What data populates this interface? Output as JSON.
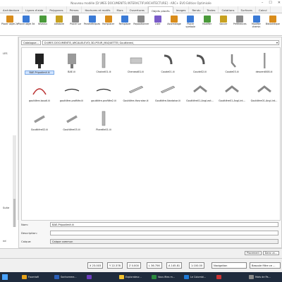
{
  "window": {
    "title": "Nouveau modèle [D:\\MES DOCUMENTS\\ INTERACTIF\\ARCHITECTURE] - ARC+ EVO Edition Optimisée"
  },
  "tabs": [
    "Architecture",
    "Lignes d'aide",
    "Polygones",
    "Primes",
    "Hachures et motifs",
    "Murs",
    "Ouvertures",
    "Objets placés",
    "Images",
    "Rendu",
    "Textes",
    "Cotations",
    "Surfaces",
    "Calcul"
  ],
  "active_tab": "Objets placés",
  "ribbon": {
    "buttons": [
      "Placer objet 2d",
      "Placer objet 3d",
      "Niveaux",
      "Aléatoire",
      "Placer sur",
      "Paramétriques",
      "Remplacer",
      "Remplacer",
      "Repositionner",
      "Liste",
      "Assemblage",
      "Placer symbole",
      "Modifier",
      "Sauver",
      "Préférences",
      "Modifier chemin",
      "Bibliothèque"
    ]
  },
  "left_panel": {
    "items": [
      "LES",
      "Suite",
      "nd"
    ]
  },
  "dialog": {
    "catalogue_label": "Catalogue...",
    "path": "D:\\MES DOCUMENTS\\ ARCALIB-EVO\\ 3D-POUR_MAQUETTE\\ Gouttieres\\",
    "items": [
      {
        "label": "BAE-Pripodimé.iii",
        "thumb": "box-black",
        "selected": true
      },
      {
        "label": "BAE.iii",
        "thumb": "box-gray"
      },
      {
        "label": "Chainel01.iii",
        "thumb": "pipe"
      },
      {
        "label": "Chenead01.iii",
        "thumb": "gutter"
      },
      {
        "label": "Coude01.iii",
        "thumb": "elbow"
      },
      {
        "label": "Coude02.iii",
        "thumb": "elbow"
      },
      {
        "label": "Coude03.iii",
        "thumb": "pipe-bend"
      },
      {
        "label": "descent008.iii",
        "thumb": "pipe-long"
      },
      {
        "label": "gouttière-boudl.iii",
        "thumb": "arc-red"
      },
      {
        "label": "gouttière-profilée.iii",
        "thumb": "gutter-thin"
      },
      {
        "label": "gouttière-profilée2.iii",
        "thumb": "gutter-thin"
      },
      {
        "label": "Gouttière-Havraise.iii",
        "thumb": "gutter-long"
      },
      {
        "label": "Gouttière-Nantaise.iii",
        "thumb": "gutter-long"
      },
      {
        "label": "Gouttière01-Angl-ext...",
        "thumb": "angle"
      },
      {
        "label": "Gouttière01-Angl-int...",
        "thumb": "angle"
      },
      {
        "label": "Gouttière01-Angl-int...",
        "thumb": "angle"
      },
      {
        "label": "Gouttière02.iii",
        "thumb": "gutter-short"
      },
      {
        "label": "Gouttière03.iii",
        "thumb": "gutter-short"
      },
      {
        "label": "Pizzette01.iii",
        "thumb": "pipe"
      }
    ],
    "fields": {
      "name_label": "Nom:",
      "name_value": "BAE-Pripodimé.iii",
      "desc_label": "Description:",
      "desc_value": "",
      "layer_label": "Calque:",
      "layer_value": "Calque commun"
    }
  },
  "status": {
    "placement": "Placement",
    "hint": "Dans un..."
  },
  "toolbar2": {
    "coord_x": "X 23.003",
    "coord_y": "Y 22.378",
    "coord_z": "Z 0.000",
    "length": "L 36.756",
    "angle": "A 145.81",
    "scale": "1:100.00",
    "mode": "Navigation",
    "filter": "Basoule filtre ce ..."
  },
  "taskbar": [
    {
      "label": "Fournisél",
      "color": "#e6a21b"
    },
    {
      "label": "Sonhomme...",
      "color": "#2b5fb8"
    },
    {
      "label": "",
      "color": "#6c3dbf"
    },
    {
      "label": "Explorateur...",
      "color": "#f2c230"
    },
    {
      "label": "Vous êtes m...",
      "color": "#2b8a3e"
    },
    {
      "label": "Le Colombi...",
      "color": "#1f7ad6"
    },
    {
      "label": "",
      "color": "#c33"
    },
    {
      "label": "Mots de Pa...",
      "color": "#888"
    }
  ]
}
